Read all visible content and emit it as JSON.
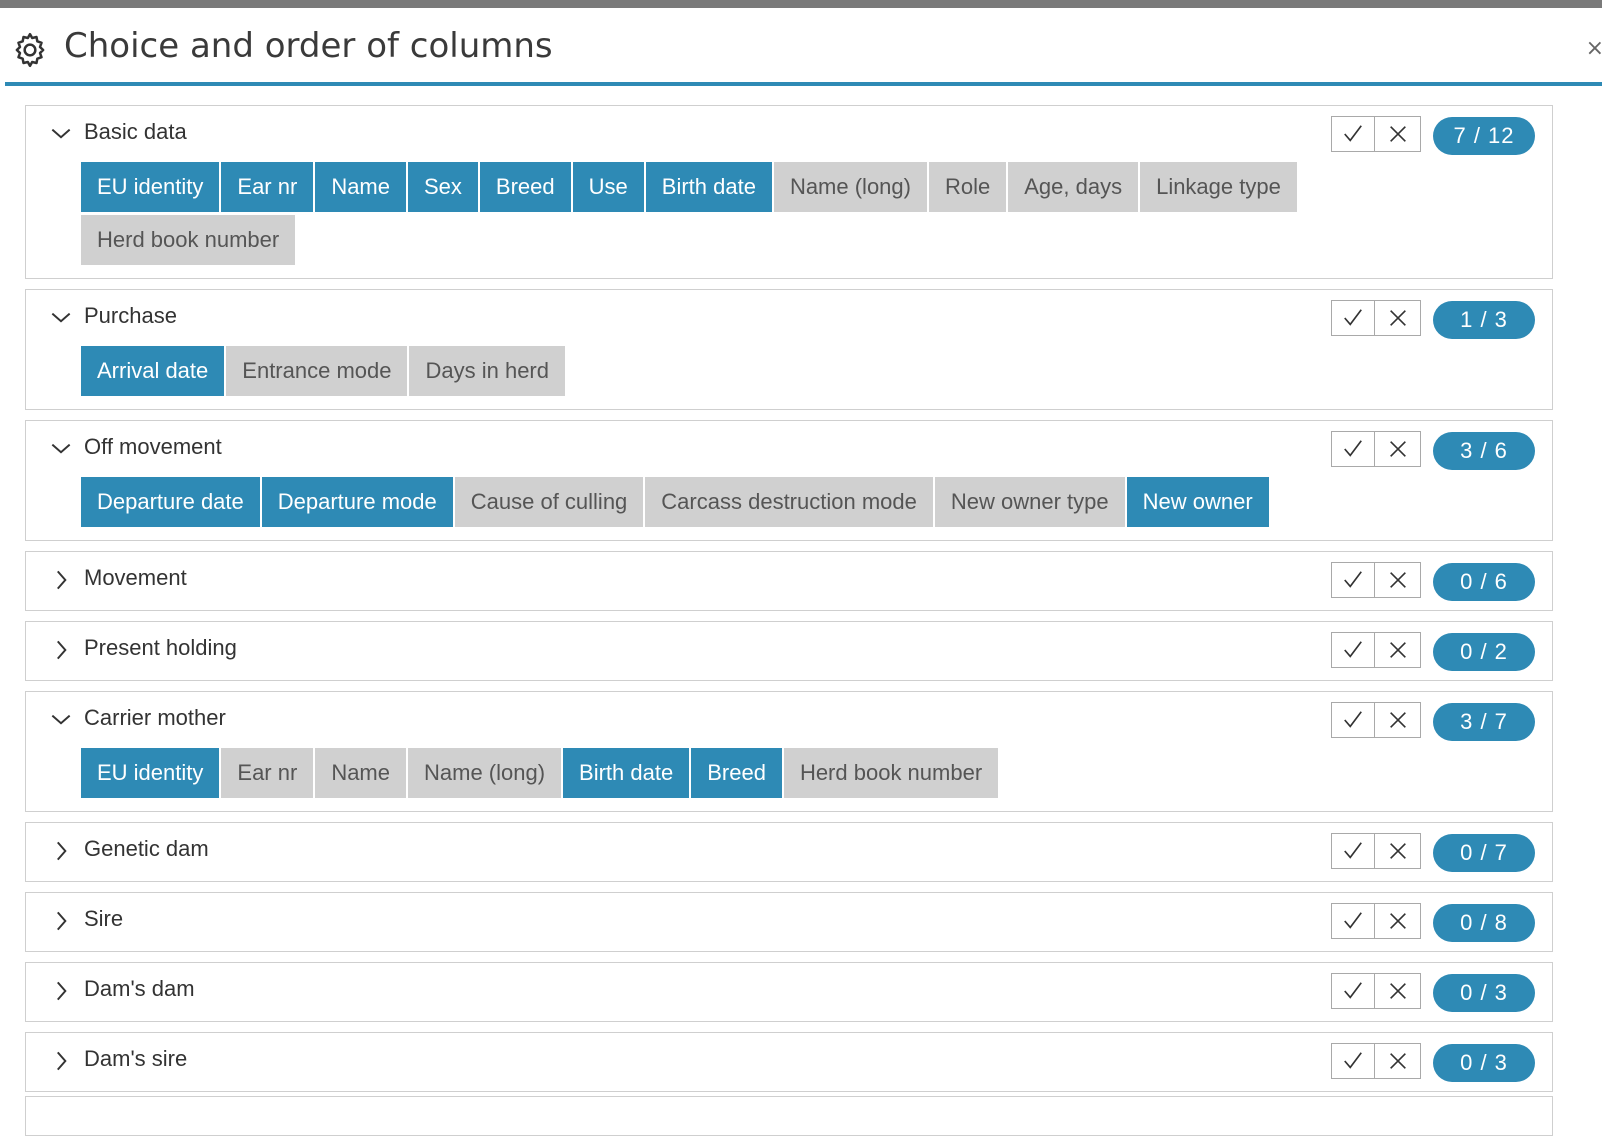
{
  "dialog": {
    "title": "Choice and order of columns",
    "close_label": "×",
    "icon": "gear-icon"
  },
  "colors": {
    "accent": "#2e8ab5",
    "chip_on": "#2e8ab5",
    "chip_off": "#d0d0d0"
  },
  "groups": [
    {
      "name": "Basic data",
      "expanded": true,
      "count": "7 / 12",
      "columns": [
        {
          "label": "EU identity",
          "selected": true
        },
        {
          "label": "Ear nr",
          "selected": true
        },
        {
          "label": "Name",
          "selected": true
        },
        {
          "label": "Sex",
          "selected": true
        },
        {
          "label": "Breed",
          "selected": true
        },
        {
          "label": "Use",
          "selected": true
        },
        {
          "label": "Birth date",
          "selected": true
        },
        {
          "label": "Name (long)",
          "selected": false
        },
        {
          "label": "Role",
          "selected": false
        },
        {
          "label": "Age, days",
          "selected": false
        },
        {
          "label": "Linkage type",
          "selected": false
        },
        {
          "label": "Herd book number",
          "selected": false
        }
      ]
    },
    {
      "name": "Purchase",
      "expanded": true,
      "count": "1 / 3",
      "columns": [
        {
          "label": "Arrival date",
          "selected": true
        },
        {
          "label": "Entrance mode",
          "selected": false
        },
        {
          "label": "Days in herd",
          "selected": false
        }
      ]
    },
    {
      "name": "Off movement",
      "expanded": true,
      "count": "3 / 6",
      "columns": [
        {
          "label": "Departure date",
          "selected": true
        },
        {
          "label": "Departure mode",
          "selected": true
        },
        {
          "label": "Cause of culling",
          "selected": false
        },
        {
          "label": "Carcass destruction mode",
          "selected": false
        },
        {
          "label": "New owner type",
          "selected": false
        },
        {
          "label": "New owner",
          "selected": true
        }
      ]
    },
    {
      "name": "Movement",
      "expanded": false,
      "count": "0 / 6",
      "columns": []
    },
    {
      "name": "Present holding",
      "expanded": false,
      "count": "0 / 2",
      "columns": []
    },
    {
      "name": "Carrier mother",
      "expanded": true,
      "count": "3 / 7",
      "columns": [
        {
          "label": "EU identity",
          "selected": true
        },
        {
          "label": "Ear nr",
          "selected": false
        },
        {
          "label": "Name",
          "selected": false
        },
        {
          "label": "Name (long)",
          "selected": false
        },
        {
          "label": "Birth date",
          "selected": true
        },
        {
          "label": "Breed",
          "selected": true
        },
        {
          "label": "Herd book number",
          "selected": false
        }
      ]
    },
    {
      "name": "Genetic dam",
      "expanded": false,
      "count": "0 / 7",
      "columns": []
    },
    {
      "name": "Sire",
      "expanded": false,
      "count": "0 / 8",
      "columns": []
    },
    {
      "name": "Dam's dam",
      "expanded": false,
      "count": "0 / 3",
      "columns": []
    },
    {
      "name": "Dam's sire",
      "expanded": false,
      "count": "0 / 3",
      "columns": []
    }
  ]
}
